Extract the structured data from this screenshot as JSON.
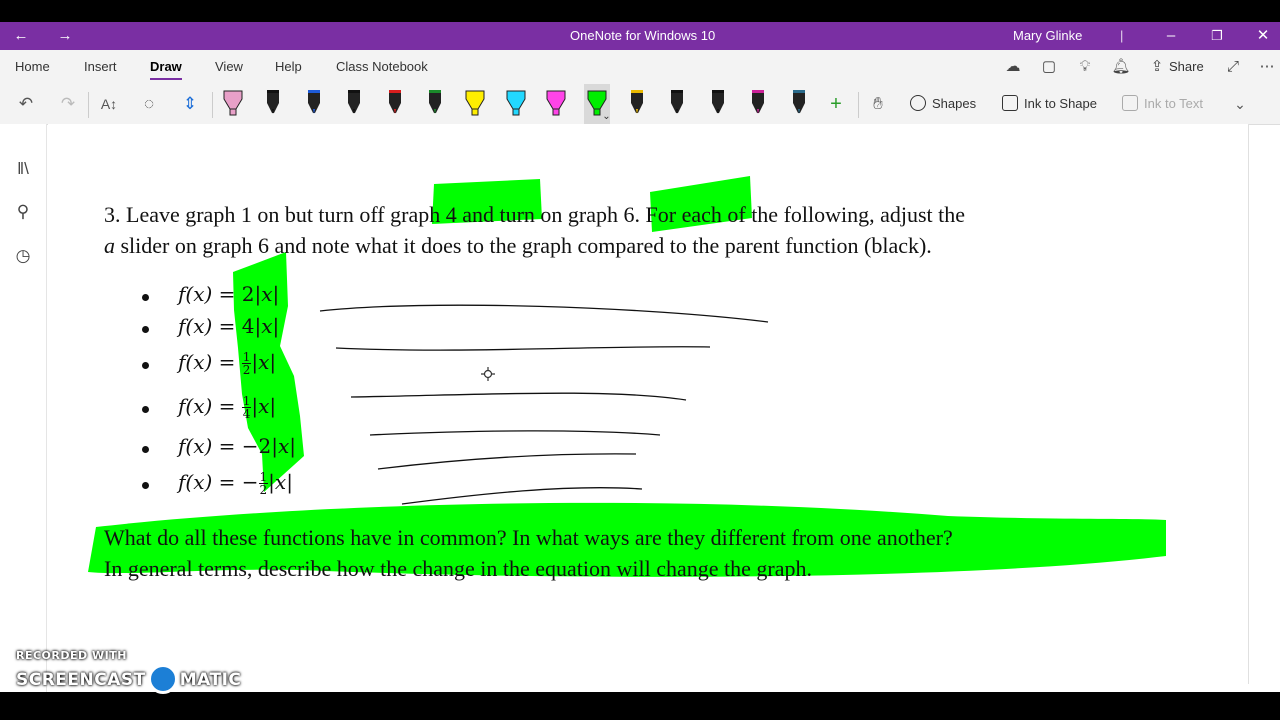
{
  "colors": {
    "accent": "#7a2fa3",
    "highlight": "#00ff00"
  },
  "titlebar": {
    "title": "OneNote for Windows 10",
    "user": "Mary Glinke",
    "back_icon": "arrow-left-icon",
    "forward_icon": "arrow-right-icon"
  },
  "menu": {
    "tabs": [
      {
        "label": "Home"
      },
      {
        "label": "Insert"
      },
      {
        "label": "Draw",
        "active": true
      },
      {
        "label": "View"
      },
      {
        "label": "Help"
      },
      {
        "label": "Class Notebook"
      }
    ],
    "share_label": "Share"
  },
  "toolbar": {
    "shapes_label": "Shapes",
    "ink_to_shape_label": "Ink to Shape",
    "ink_to_text_label": "Ink to Text",
    "pens": [
      {
        "name": "pink-highlighter",
        "color": "#e8a0c8",
        "highlighter": true
      },
      {
        "name": "black-pen-1",
        "color": "#111111"
      },
      {
        "name": "blue-pen-1",
        "color": "#1e5bd8"
      },
      {
        "name": "black-pen-2",
        "color": "#111111"
      },
      {
        "name": "red-pen",
        "color": "#d81e1e"
      },
      {
        "name": "green-pen",
        "color": "#1a8a2a"
      },
      {
        "name": "yellow-highlighter",
        "color": "#ffee00",
        "highlighter": true
      },
      {
        "name": "cyan-highlighter",
        "color": "#22d8ff",
        "highlighter": true
      },
      {
        "name": "magenta-highlighter",
        "color": "#ff44e8",
        "highlighter": true
      },
      {
        "name": "green-highlighter",
        "color": "#00ee00",
        "highlighter": true,
        "selected": true
      },
      {
        "name": "gold-pen",
        "color": "#e8b800"
      },
      {
        "name": "black-pen-3",
        "color": "#111111"
      },
      {
        "name": "black-pen-4",
        "color": "#111111"
      },
      {
        "name": "galaxy-pen",
        "color": "#cc2299"
      },
      {
        "name": "teal-pen",
        "color": "#2a6a8a"
      }
    ]
  },
  "note": {
    "instruction_line1": "3.  Leave graph 1 on but turn off graph 4 and turn on graph 6.  For each of the following, adjust the",
    "instruction_line2_var": "a",
    "instruction_line2": " slider on graph 6 and note what it does to the graph compared to the parent function (black).",
    "functions": [
      {
        "lhs": "f(x) = ",
        "coef": "2",
        "rhs": "|x|"
      },
      {
        "lhs": "f(x) = ",
        "coef": "4",
        "rhs": "|x|"
      },
      {
        "lhs": "f(x) = ",
        "frac_num": "1",
        "frac_den": "2",
        "rhs": "|x|"
      },
      {
        "lhs": "f(x) = ",
        "frac_num": "1",
        "frac_den": "4",
        "rhs": "|x|"
      },
      {
        "lhs": "f(x) = ",
        "coef": "−2",
        "rhs": "|x|"
      },
      {
        "lhs": "f(x) = ",
        "sign": "−",
        "frac_num": "1",
        "frac_den": "2",
        "rhs": "|x|"
      }
    ],
    "question_line1": "What do all these functions have in common?  In what ways are they different from one another?",
    "question_line2": "In general terms, describe how the change in the equation will change the graph."
  },
  "watermark": {
    "line1": "RECORDED WITH",
    "left": "SCREENCAST",
    "right": "MATIC"
  }
}
